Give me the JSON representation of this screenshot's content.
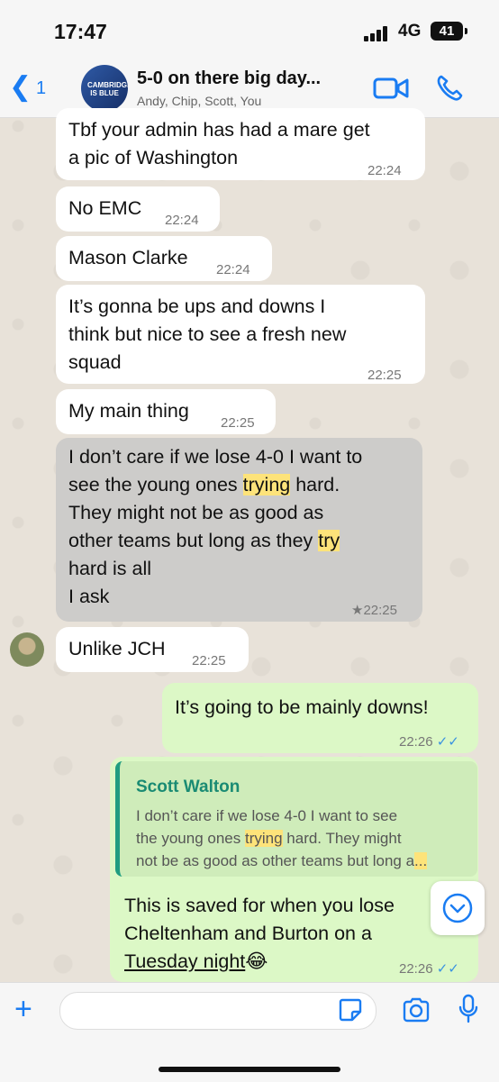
{
  "status": {
    "time": "17:47",
    "network": "4G",
    "battery": "41"
  },
  "header": {
    "back_count": "1",
    "title": "5-0 on there big day...",
    "members": "Andy, Chip, Scott, You",
    "avatar_text": "CAMBRIDGESHIRE IS BLUE"
  },
  "messages": [
    {
      "line1": "Tbf your admin has had a mare get",
      "line2": "a pic of Washington",
      "time": "22:24"
    },
    {
      "text": "No EMC",
      "time": "22:24"
    },
    {
      "text": "Mason Clarke",
      "time": "22:24"
    },
    {
      "line1": "It’s gonna be ups and downs I",
      "line2": "think but nice to see a fresh new",
      "line3": "squad",
      "time": "22:25"
    },
    {
      "text": "My main thing",
      "time": "22:25"
    },
    {
      "p1": "I don’t  care if we lose 4-0 I want to",
      "p2": "see the young ones ",
      "hl1": "trying",
      "p3": " hard.",
      "p4": "They might not be as good as",
      "p5": "other teams but long as they ",
      "hl2": "try",
      "p6": "hard is all",
      "p7": "I ask",
      "time": "22:25",
      "star": "★"
    },
    {
      "text": "Unlike JCH",
      "time": "22:25"
    },
    {
      "text": "It’s going to be mainly downs!",
      "time": "22:26",
      "ticks": "✓✓"
    },
    {
      "quote_name": "Scott Walton",
      "quote_l1": "I don’t  care if we lose 4-0 I want to see",
      "quote_l2a": "the young ones ",
      "quote_hl1": "trying",
      "quote_l2b": " hard. They might",
      "quote_l3a": "not be as good as other teams but long a",
      "quote_hl2": "...",
      "line1": "This is saved for when you lose",
      "line2": "Cheltenham and Burton on a",
      "line3": "Tuesday night",
      "emoji": "😂",
      "time": "22:26",
      "ticks": "✓✓"
    }
  ],
  "colors": {
    "accent": "#1a7cf2",
    "outgoing": "#dcf8c6",
    "highlight": "#fde37a",
    "quote_name": "#1a8b73"
  }
}
